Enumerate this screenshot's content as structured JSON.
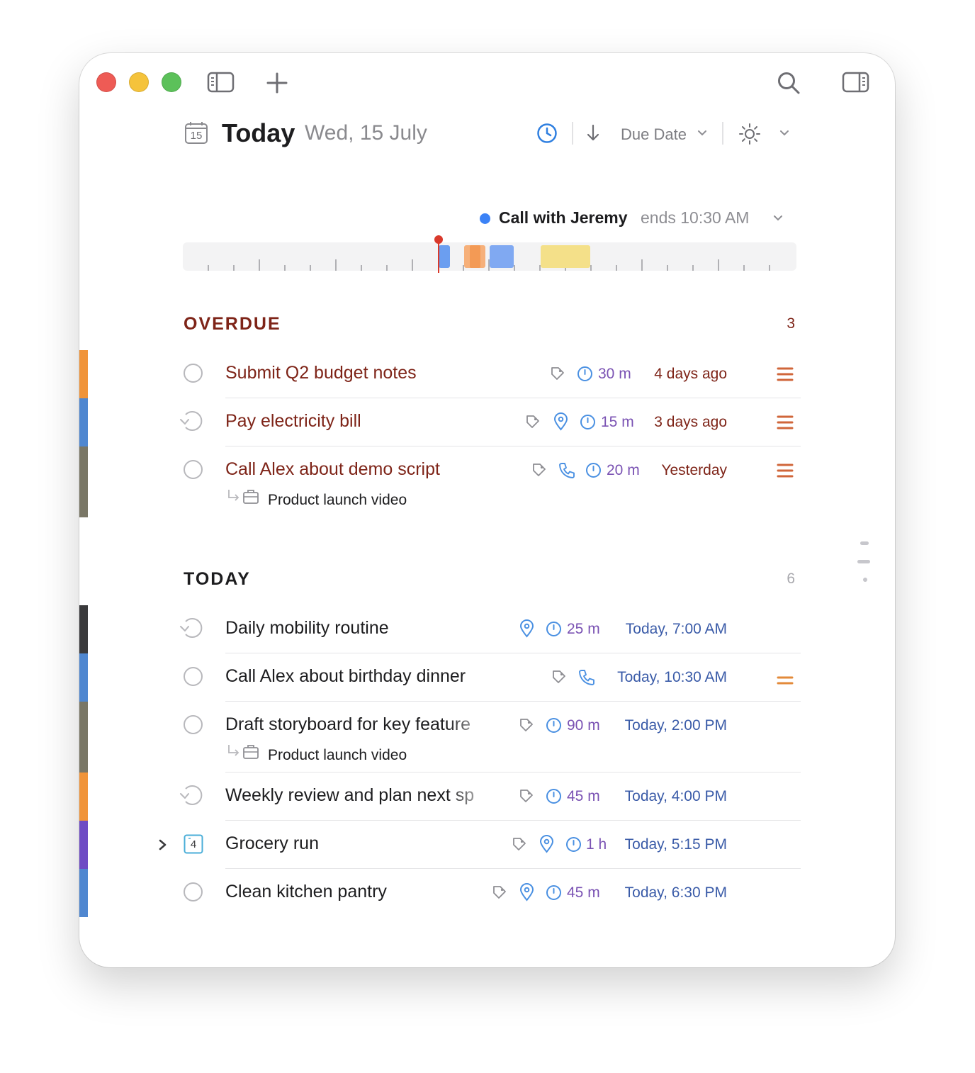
{
  "toolbar": {
    "icons": [
      "close",
      "minimize",
      "zoom",
      "sidebar-left-icon",
      "plus-icon",
      "search-icon",
      "sidebar-right-icon"
    ]
  },
  "header": {
    "calendar_day": "15",
    "title": "Today",
    "date": "Wed, 15 July",
    "sort_label": "Due Date"
  },
  "timeline": {
    "event_title": "Call with Jeremy",
    "event_end": "ends 10:30 AM",
    "event_color": "#3b82f6",
    "now_color": "#d9392b"
  },
  "overdue": {
    "label": "OVERDUE",
    "count": "3",
    "color": "#7e2418",
    "tasks": [
      {
        "title": "Submit Q2 budget notes",
        "duration": "30 m",
        "due": "4 days ago",
        "strip_color": "#f0943a",
        "icons": [
          "tag-icon",
          "clock-icon"
        ],
        "priority": "high"
      },
      {
        "title": "Pay electricity bill",
        "duration": "15 m",
        "due": "3 days ago",
        "strip_color": "#4f87d0",
        "icons": [
          "tag-icon",
          "location-icon",
          "clock-icon"
        ],
        "priority": "high",
        "repeat": true
      },
      {
        "title": "Call Alex about demo script",
        "duration": "20 m",
        "due": "Yesterday",
        "strip_color": "#7a7766",
        "icons": [
          "tag-icon",
          "phone-icon",
          "clock-icon"
        ],
        "priority": "high",
        "project": "Product launch video"
      }
    ]
  },
  "today": {
    "label": "TODAY",
    "count": "6",
    "color": "#1d1d1f",
    "tasks": [
      {
        "title": "Daily mobility routine",
        "duration": "25 m",
        "due": "Today, 7:00 AM",
        "strip_color": "#3a3a3c",
        "icons": [
          "location-icon",
          "clock-icon"
        ],
        "repeat": true
      },
      {
        "title": "Call Alex about birthday dinner",
        "duration": "",
        "due": "Today, 10:30 AM",
        "strip_color": "#4f87d0",
        "icons": [
          "tag-icon",
          "phone-icon"
        ],
        "priority": "medium"
      },
      {
        "title": "Draft storyboard for key feature",
        "duration": "90 m",
        "due": "Today, 2:00 PM",
        "strip_color": "#7a7766",
        "icons": [
          "tag-icon",
          "clock-icon"
        ],
        "project": "Product launch video"
      },
      {
        "title": "Weekly review and plan next sp",
        "duration": "45 m",
        "due": "Today, 4:00 PM",
        "strip_color": "#f0943a",
        "icons": [
          "tag-icon",
          "clock-icon"
        ],
        "repeat": true
      },
      {
        "title": "Grocery run",
        "duration": "1 h",
        "due": "Today, 5:15 PM",
        "strip_color": "#6e4bc4",
        "icons": [
          "tag-icon",
          "location-icon",
          "clock-icon"
        ],
        "checklist_count": "4"
      },
      {
        "title": "Clean kitchen pantry",
        "duration": "45 m",
        "due": "Today, 6:30 PM",
        "strip_color": "#4f87d0",
        "icons": [
          "tag-icon",
          "location-icon",
          "clock-icon"
        ]
      }
    ]
  },
  "colors": {
    "overdue_text": "#7e2418",
    "meta_blue": "#3a5ba8",
    "duration_purple": "#7a52b3",
    "icon_blue": "#4a90e2",
    "priority_high": "#d0663a",
    "priority_medium": "#e38a3a"
  }
}
